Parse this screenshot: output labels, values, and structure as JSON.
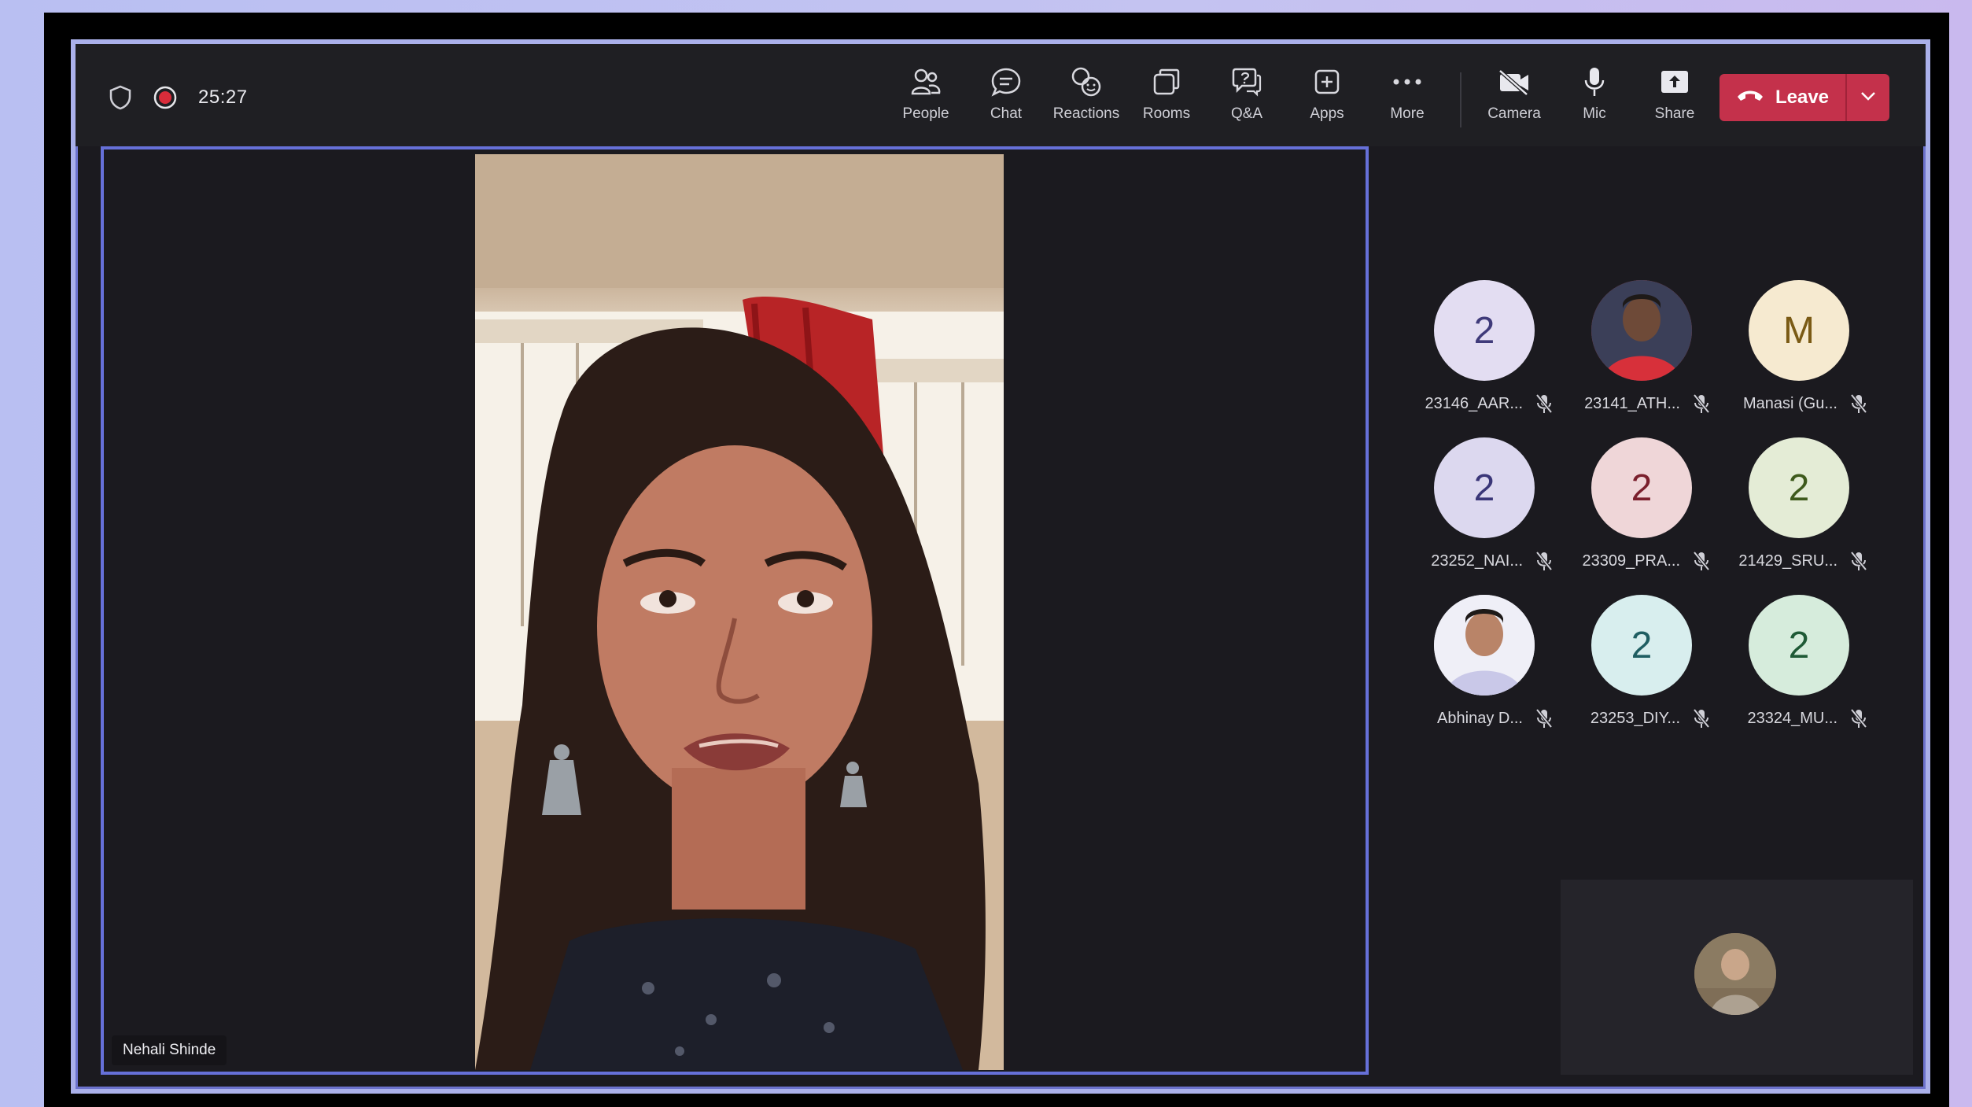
{
  "window": {
    "timer": "25:27",
    "icons": {
      "shield": "shield-icon",
      "recording": "recording-dot-icon"
    }
  },
  "toolbar": {
    "buttons": [
      {
        "label": "People",
        "icon": "people-icon"
      },
      {
        "label": "Chat",
        "icon": "chat-icon"
      },
      {
        "label": "Reactions",
        "icon": "reactions-icon"
      },
      {
        "label": "Rooms",
        "icon": "rooms-icon"
      },
      {
        "label": "Q&A",
        "icon": "qa-icon"
      },
      {
        "label": "Apps",
        "icon": "apps-icon"
      },
      {
        "label": "More",
        "icon": "more-icon"
      }
    ],
    "devices": [
      {
        "label": "Camera",
        "icon": "camera-off-icon"
      },
      {
        "label": "Mic",
        "icon": "mic-icon"
      },
      {
        "label": "Share",
        "icon": "share-icon"
      }
    ],
    "leave_label": "Leave"
  },
  "stage": {
    "speaker_name": "Nehali Shinde"
  },
  "gallery": {
    "participants": [
      {
        "name": "23146_AAR...",
        "initial": "2",
        "bg": "#e3ddf2",
        "fg": "#3f3a7a",
        "photo": false
      },
      {
        "name": "23141_ATH...",
        "initial": "",
        "bg": "#c63a3a",
        "fg": "#ffffff",
        "photo": true
      },
      {
        "name": "Manasi (Gu...",
        "initial": "M",
        "bg": "#f6ead0",
        "fg": "#7a5a14",
        "photo": false
      },
      {
        "name": "23252_NAI...",
        "initial": "2",
        "bg": "#dcd8ef",
        "fg": "#3a3678",
        "photo": false
      },
      {
        "name": "23309_PRA...",
        "initial": "2",
        "bg": "#efd6d8",
        "fg": "#7a1f2c",
        "photo": false
      },
      {
        "name": "21429_SRU...",
        "initial": "2",
        "bg": "#e4ecd6",
        "fg": "#3e5a1c",
        "photo": false
      },
      {
        "name": "Abhinay D...",
        "initial": "",
        "bg": "#e8e6f4",
        "fg": "#333333",
        "photo": true
      },
      {
        "name": "23253_DIY...",
        "initial": "2",
        "bg": "#d8eeee",
        "fg": "#1f5e62",
        "photo": false
      },
      {
        "name": "23324_MU...",
        "initial": "2",
        "bg": "#d6ecdc",
        "fg": "#1f5a36",
        "photo": false
      }
    ]
  },
  "colors": {
    "leave": "#c4314b",
    "stage_border": "#6670d8"
  }
}
